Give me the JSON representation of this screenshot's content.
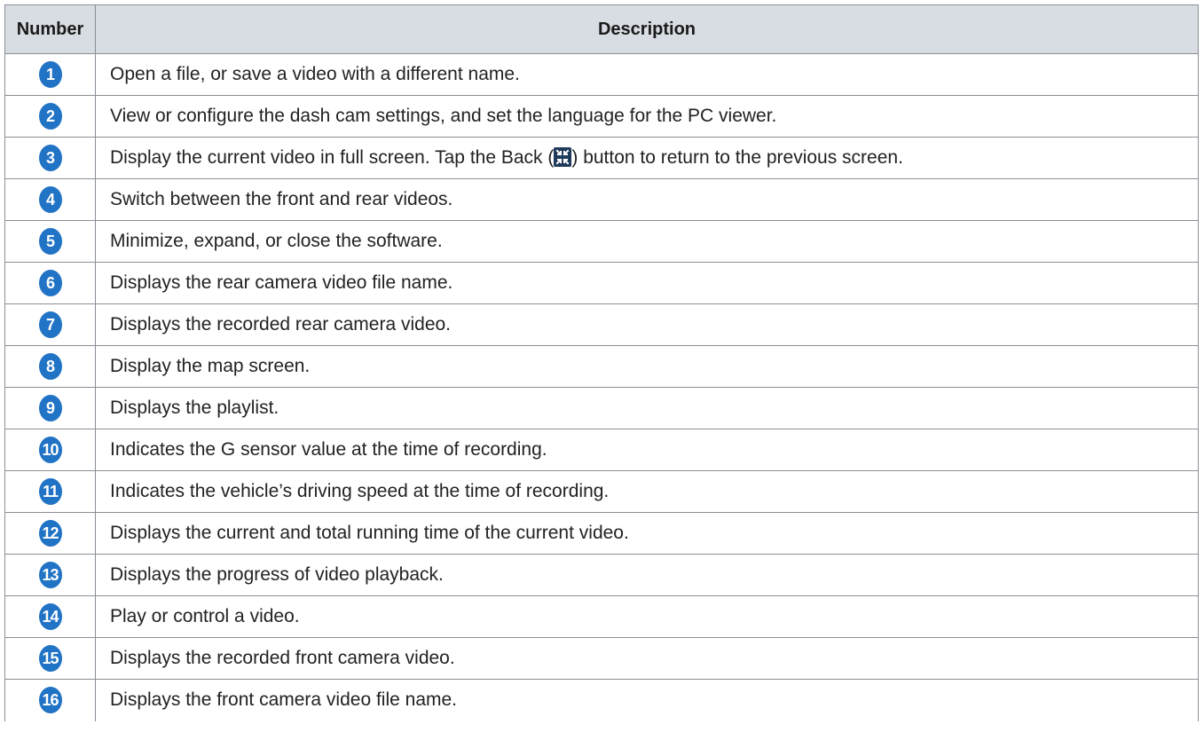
{
  "table": {
    "headers": {
      "number": "Number",
      "description": "Description"
    },
    "rows": [
      {
        "number": "1",
        "text": "Open a file, or save a video with a different name."
      },
      {
        "number": "2",
        "text": "View or configure the dash cam settings, and set the language for the PC viewer."
      },
      {
        "number": "3",
        "text_before": "Display the current video in full screen. Tap the Back (",
        "icon": "exit-fullscreen-icon",
        "text_after": ") button to return to the previous screen."
      },
      {
        "number": "4",
        "text": "Switch between the front and rear videos."
      },
      {
        "number": "5",
        "text": "Minimize, expand, or close the software."
      },
      {
        "number": "6",
        "text": "Displays the rear camera video file name."
      },
      {
        "number": "7",
        "text": "Displays the recorded rear camera video."
      },
      {
        "number": "8",
        "text": "Display the map screen."
      },
      {
        "number": "9",
        "text": "Displays the playlist."
      },
      {
        "number": "10",
        "text": "Indicates the G sensor value at the time of recording."
      },
      {
        "number": "11",
        "text": "Indicates the vehicle’s driving speed at the time of recording."
      },
      {
        "number": "12",
        "text": "Displays the current and total running time of the current video."
      },
      {
        "number": "13",
        "text": "Displays the progress of video playback."
      },
      {
        "number": "14",
        "text": "Play or control a video."
      },
      {
        "number": "15",
        "text": "Displays the recorded front camera video."
      },
      {
        "number": "16",
        "text": "Displays the front camera video file name."
      }
    ]
  },
  "colors": {
    "header_bg": "#d8dde3",
    "number_badge": "#2173c5",
    "border": "#8a8f96"
  }
}
